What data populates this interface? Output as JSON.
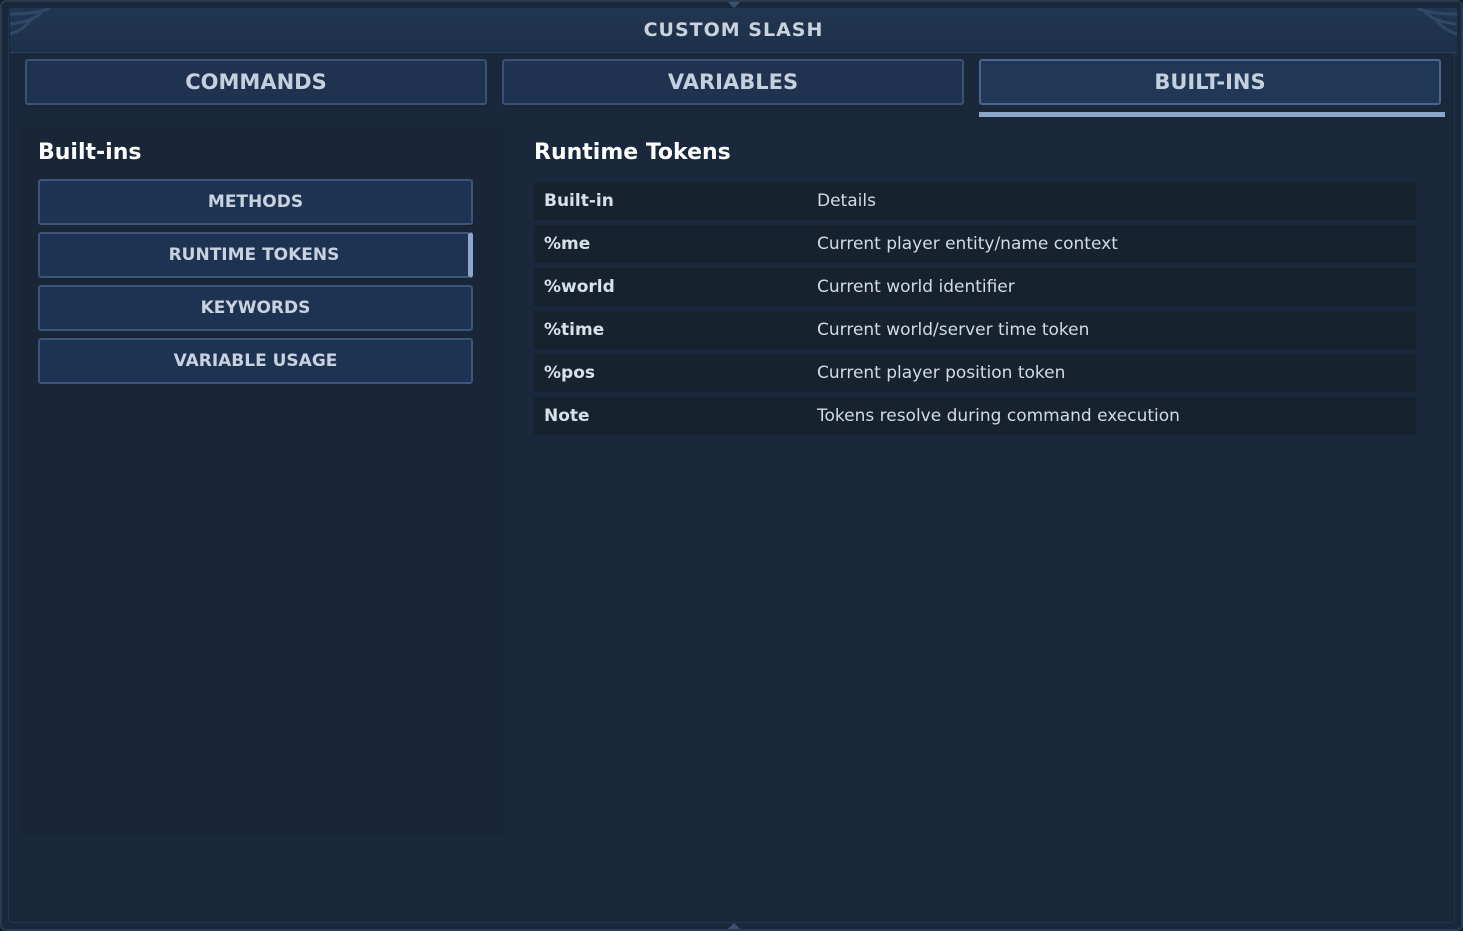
{
  "window": {
    "title": "CUSTOM SLASH"
  },
  "tabs": [
    {
      "label": "COMMANDS"
    },
    {
      "label": "VARIABLES"
    },
    {
      "label": "BUILT-INS"
    }
  ],
  "active_tab": "BUILT-INS",
  "sidebar": {
    "heading": "Built-ins",
    "items": [
      {
        "label": "METHODS"
      },
      {
        "label": "RUNTIME TOKENS"
      },
      {
        "label": "KEYWORDS"
      },
      {
        "label": "VARIABLE USAGE"
      }
    ],
    "active_item": "RUNTIME TOKENS"
  },
  "content": {
    "heading": "Runtime Tokens",
    "table": {
      "header": {
        "key": "Built-in",
        "value": "Details"
      },
      "rows": [
        {
          "key": "%me",
          "value": "Current player entity/name context"
        },
        {
          "key": "%world",
          "value": "Current world identifier"
        },
        {
          "key": "%time",
          "value": "Current world/server time token"
        },
        {
          "key": "%pos",
          "value": "Current player position token"
        },
        {
          "key": "Note",
          "value": "Tokens resolve during command execution"
        }
      ]
    }
  },
  "colors": {
    "background": "#19283a",
    "accent": "#8ba7cc",
    "button_fill": "#1e3352",
    "button_border": "#3d5579"
  }
}
